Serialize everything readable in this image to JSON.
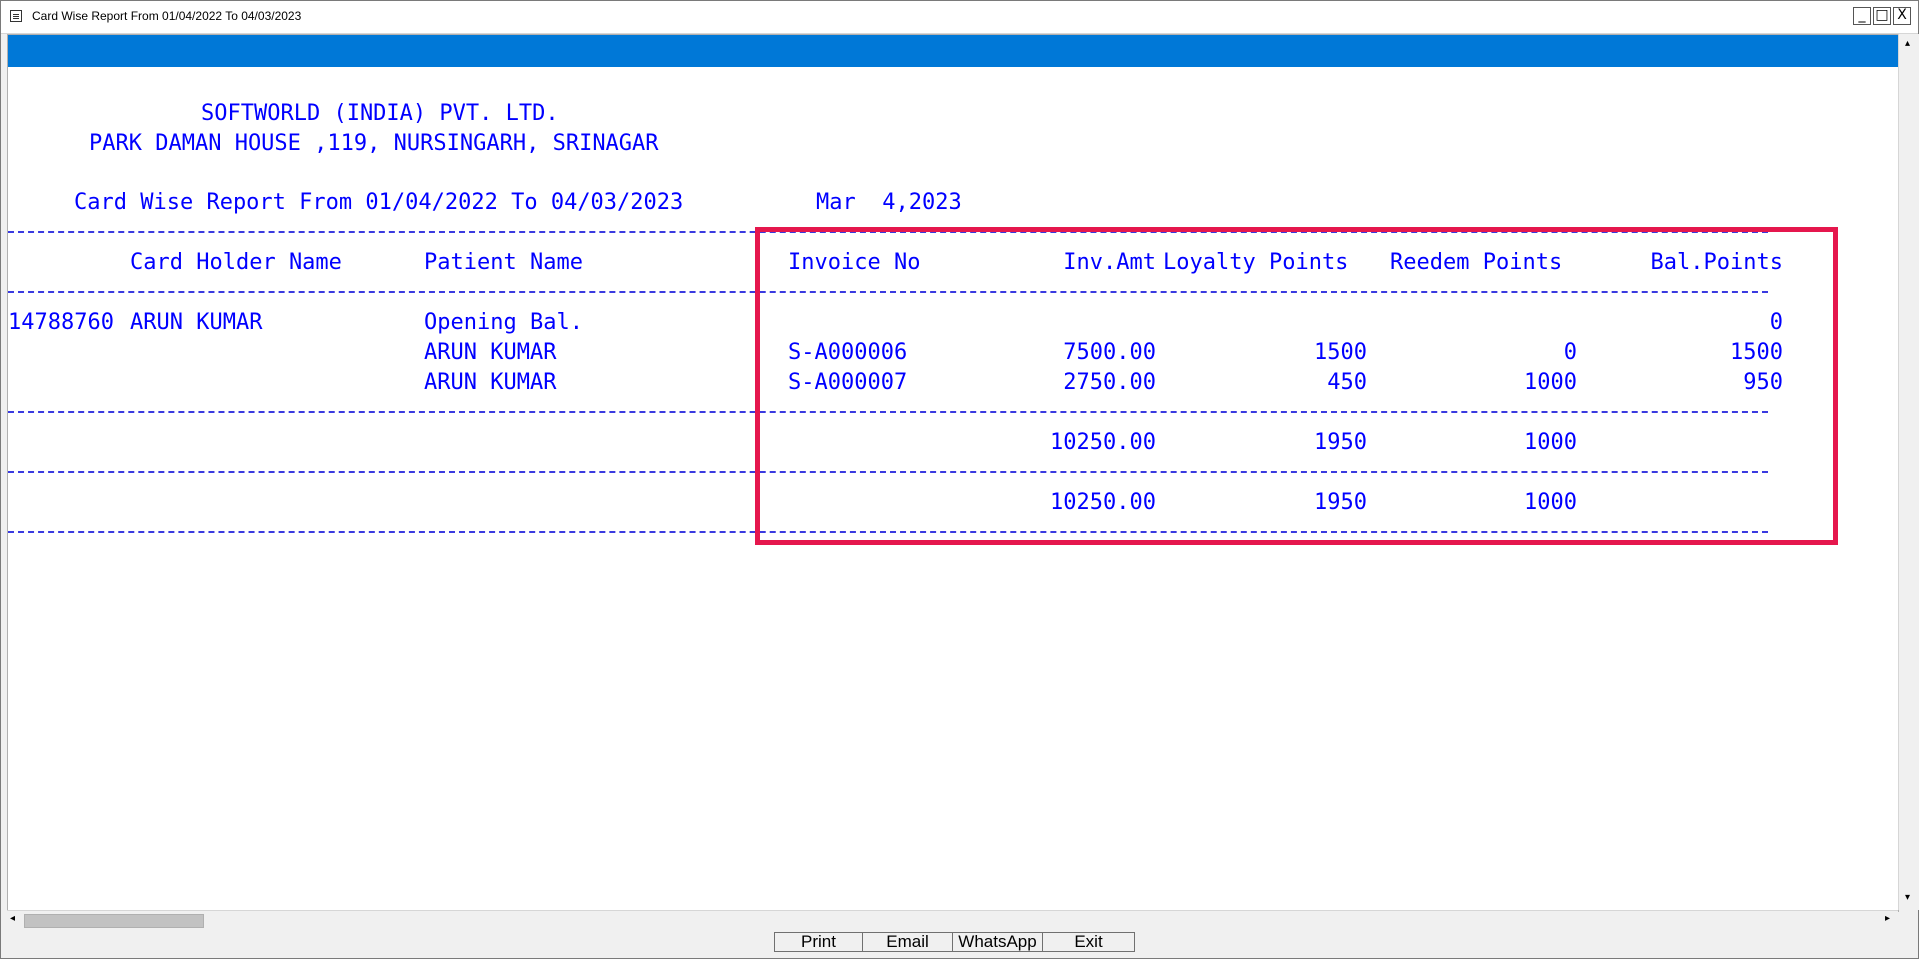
{
  "window": {
    "title": "Card Wise Report From 01/04/2022 To 04/03/2023",
    "controls": {
      "minimize": "_",
      "maximize": "□",
      "close": "X"
    }
  },
  "report": {
    "company": "SOFTWORLD (INDIA) PVT. LTD.",
    "address": "PARK DAMAN HOUSE ,119, NURSINGARH, SRINAGAR",
    "heading": "Card Wise Report From 01/04/2022 To 04/03/2023",
    "print_date": "Mar  4,2023",
    "columns": {
      "card_holder": "Card Holder Name",
      "patient": "Patient Name",
      "invoice": "Invoice No",
      "inv_amt": "Inv.Amt",
      "loyalty": "Loyalty Points",
      "redeem": "Reedem Points",
      "balance": "Bal.Points"
    },
    "card_no": "14788760",
    "card_holder_name": "ARUN KUMAR",
    "rows": [
      {
        "patient": "Opening Bal.",
        "invoice": "",
        "inv_amt": "",
        "loyalty": "",
        "redeem": "",
        "balance": "0"
      },
      {
        "patient": "ARUN KUMAR",
        "invoice": "S-A000006",
        "inv_amt": "7500.00",
        "loyalty": "1500",
        "redeem": "0",
        "balance": "1500"
      },
      {
        "patient": "ARUN KUMAR",
        "invoice": "S-A000007",
        "inv_amt": "2750.00",
        "loyalty": "450",
        "redeem": "1000",
        "balance": "950"
      }
    ],
    "subtotal": {
      "inv_amt": "10250.00",
      "loyalty": "1950",
      "redeem": "1000"
    },
    "grand_total": {
      "inv_amt": "10250.00",
      "loyalty": "1950",
      "redeem": "1000"
    }
  },
  "scroll": {
    "left_arrow": "◂",
    "right_arrow": "▸",
    "up_arrow": "▴",
    "down_arrow": "▾"
  },
  "buttons": {
    "print": "Print",
    "email": "Email",
    "whatsapp": "WhatsApp",
    "exit": "Exit"
  },
  "colors": {
    "report_text": "#0000ff",
    "title_band": "#0078d7",
    "highlight_box": "#e5174d"
  }
}
